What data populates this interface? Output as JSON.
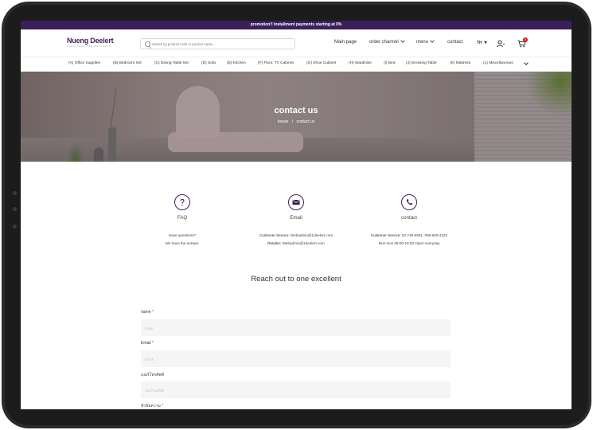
{
  "promo": {
    "text": "promotion!! Installment payments starting at 0%"
  },
  "brand": {
    "name": "Nueng Deelert",
    "tagline": "FURNITURE AND MATTRESS"
  },
  "search": {
    "placeholder": "Search by product code or product name..."
  },
  "nav": {
    "main": "Main page",
    "order": "order channel",
    "menu": "menu",
    "contact": "contact",
    "lang": "TH",
    "cart_count": "0"
  },
  "categories": [
    "(A) Office Supplies",
    "(B) Bedroom Set",
    "(C) Dining Table Set",
    "(D) Sofa",
    "(E) Kitchen",
    "(F) Floor, TV Cabinet",
    "(G) Shoe Cabinet",
    "(H) Wardrobe",
    "(I) Bed",
    "(J) Dressing Table",
    "(K) Mattress",
    "(L) Miscellaneous"
  ],
  "hero": {
    "title": "contact us",
    "crumb_home": "house",
    "crumb_sep": "/",
    "crumb_current": "contact us"
  },
  "faq": {
    "label": "FAQ",
    "line1": "Have questions?",
    "line2": "We have the answer."
  },
  "email": {
    "label": "Email",
    "cs_key": "Customer Service:",
    "cs_val": "Webadmin@1deelert.com",
    "retail_key": "Retailer:",
    "retail_val": "Webadmin@1deelert.com"
  },
  "phone": {
    "label": "contact",
    "cs_key": "Customer Service:",
    "cs_val": "02-745-5961, 086-600-4332",
    "hours": "Mon-Sun 09:00-19:00 Open everyday"
  },
  "form": {
    "heading": "Reach out to one excellent",
    "name_label": "name",
    "name_placeholder": "name",
    "email_label": "Email",
    "email_placeholder": "Email",
    "phone_label": "เบอร์โทรศัพท์",
    "phone_placeholder": "เบอร์โทรศัพท์",
    "subject_label": "หัวข้อความ",
    "req": "*"
  }
}
